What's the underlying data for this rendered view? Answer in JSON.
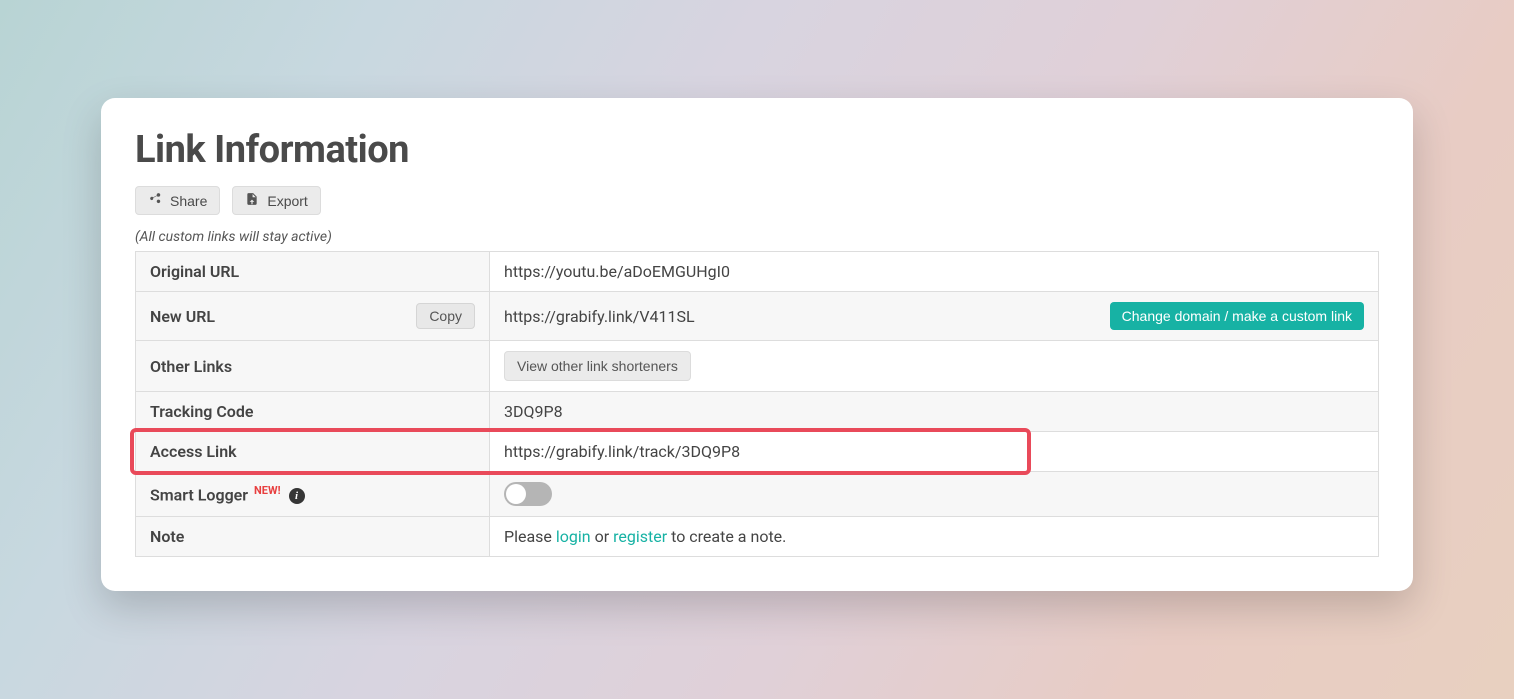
{
  "title": "Link Information",
  "actions": {
    "share_label": "Share",
    "export_label": "Export"
  },
  "subnote": "(All custom links will stay active)",
  "rows": {
    "original_url": {
      "label": "Original URL",
      "value": "https://youtu.be/aDoEMGUHgI0"
    },
    "new_url": {
      "label": "New URL",
      "copy_label": "Copy",
      "value": "https://grabify.link/V411SL",
      "change_domain_label": "Change domain / make a custom link"
    },
    "other_links": {
      "label": "Other Links",
      "button_label": "View other link shorteners"
    },
    "tracking_code": {
      "label": "Tracking Code",
      "value": "3DQ9P8"
    },
    "access_link": {
      "label": "Access Link",
      "value": "https://grabify.link/track/3DQ9P8"
    },
    "smart_logger": {
      "label": "Smart Logger",
      "badge": "NEW!"
    },
    "note": {
      "label": "Note",
      "prefix": "Please ",
      "login": "login",
      "mid": " or ",
      "register": "register",
      "suffix": " to create a note."
    }
  }
}
